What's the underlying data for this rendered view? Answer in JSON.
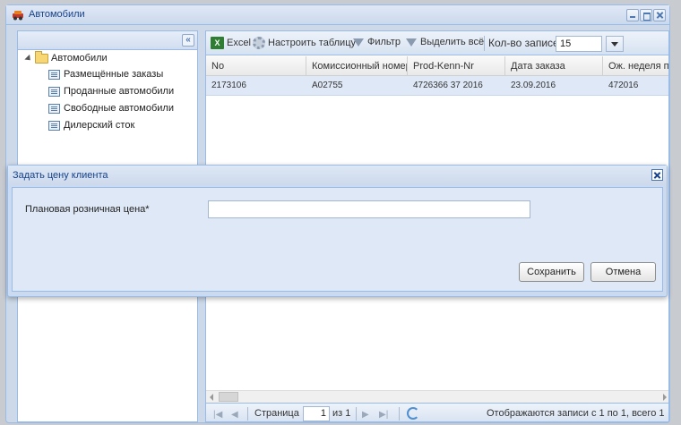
{
  "window": {
    "title": "Автомобили"
  },
  "tree": {
    "root": "Автомобили",
    "items": [
      "Размещённые заказы",
      "Проданные автомобили",
      "Свободные автомобили",
      "Дилерский сток"
    ]
  },
  "toolbar": {
    "excel": "Excel",
    "customize": "Настроить таблицу",
    "filter": "Фильтр",
    "select_all": "Выделить всё",
    "page_size_label": "Кол-во записей",
    "page_size": "15"
  },
  "grid": {
    "columns": [
      "No",
      "Комиссионный номер",
      "Prod-Kenn-Nr",
      "Дата заказа",
      "Ож. неделя пр"
    ],
    "rows": [
      [
        "2173106",
        "A02755",
        "4726366 37 2016",
        "23.09.2016",
        "472016"
      ]
    ]
  },
  "pager": {
    "page_label": "Страница",
    "page_value": "1",
    "of_label": "из 1",
    "status": "Отображаются записи с 1 по 1, всего 1"
  },
  "dialog": {
    "title": "Задать цену клиента",
    "field_label": "Плановая розничная цена*",
    "field_value": "",
    "save": "Сохранить",
    "cancel": "Отмена"
  },
  "icons": {
    "app": "car-icon",
    "excel": "excel-icon",
    "customize": "gear-icon",
    "filter": "funnel-icon",
    "select_all": "funnel-icon",
    "refresh": "refresh-icon"
  },
  "colors": {
    "title_text": "#15428b",
    "border": "#99bbe8",
    "selected_row": "#dfe8f6"
  }
}
